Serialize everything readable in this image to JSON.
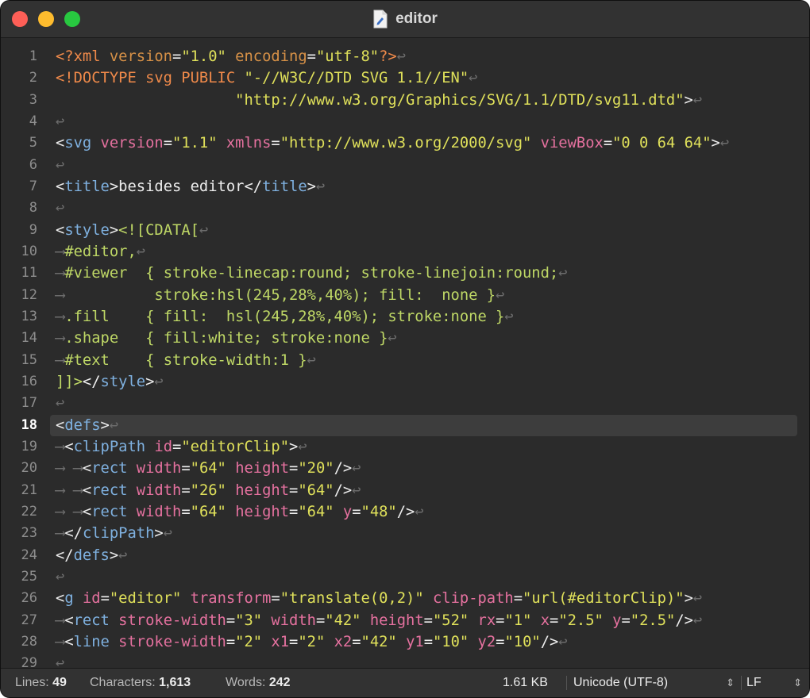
{
  "window": {
    "title": "editor"
  },
  "colors": {
    "background": "#2b2b2b",
    "tag": "#7fb1e0",
    "attribute": "#e5719f",
    "string": "#dfe05a",
    "css": "#bfd866",
    "declaration": "#f08a4a"
  },
  "editor": {
    "current_line": 18,
    "lines": [
      [
        [
          "<?xml ",
          "decl"
        ],
        [
          "version",
          "xmlattr"
        ],
        [
          "=",
          "punct"
        ],
        [
          "\"1.0\"",
          "str"
        ],
        [
          " ",
          "text"
        ],
        [
          "encoding",
          "xmlattr"
        ],
        [
          "=",
          "punct"
        ],
        [
          "\"utf-8\"",
          "str"
        ],
        [
          "?>",
          "decl"
        ],
        [
          "↩",
          "inv"
        ]
      ],
      [
        [
          "<!DOCTYPE svg PUBLIC ",
          "decl"
        ],
        [
          "\"-//W3C//DTD SVG 1.1//EN\"",
          "str"
        ],
        [
          "↩",
          "inv"
        ]
      ],
      [
        [
          "                    ",
          "text"
        ],
        [
          "\"http://www.w3.org/Graphics/SVG/1.1/DTD/svg11.dtd\"",
          "str"
        ],
        [
          ">",
          "punct"
        ],
        [
          "↩",
          "inv"
        ]
      ],
      [
        [
          "↩",
          "inv"
        ]
      ],
      [
        [
          "<",
          "punct"
        ],
        [
          "svg",
          "tag"
        ],
        [
          " ",
          "text"
        ],
        [
          "version",
          "attr"
        ],
        [
          "=",
          "punct"
        ],
        [
          "\"1.1\"",
          "str"
        ],
        [
          " ",
          "text"
        ],
        [
          "xmlns",
          "attr"
        ],
        [
          "=",
          "punct"
        ],
        [
          "\"http://www.w3.org/2000/svg\"",
          "str"
        ],
        [
          " ",
          "text"
        ],
        [
          "viewBox",
          "attr"
        ],
        [
          "=",
          "punct"
        ],
        [
          "\"0 0 64 64\"",
          "str"
        ],
        [
          ">",
          "punct"
        ],
        [
          "↩",
          "inv"
        ]
      ],
      [
        [
          "↩",
          "inv"
        ]
      ],
      [
        [
          "<",
          "punct"
        ],
        [
          "title",
          "tag"
        ],
        [
          ">",
          "punct"
        ],
        [
          "besides editor",
          "text"
        ],
        [
          "</",
          "punct"
        ],
        [
          "title",
          "tag"
        ],
        [
          ">",
          "punct"
        ],
        [
          "↩",
          "inv"
        ]
      ],
      [
        [
          "↩",
          "inv"
        ]
      ],
      [
        [
          "<",
          "punct"
        ],
        [
          "style",
          "tag"
        ],
        [
          ">",
          "punct"
        ],
        [
          "<![CDATA[",
          "css"
        ],
        [
          "↩",
          "inv"
        ]
      ],
      [
        [
          "⟶",
          "inv"
        ],
        [
          "#editor,",
          "css"
        ],
        [
          "↩",
          "inv"
        ]
      ],
      [
        [
          "⟶",
          "inv"
        ],
        [
          "#viewer  { stroke-linecap:round; stroke-linejoin:round;",
          "css"
        ],
        [
          "↩",
          "inv"
        ]
      ],
      [
        [
          "⟶",
          "inv"
        ],
        [
          "          stroke:hsl(245,28%,40%); fill:  none }",
          "css"
        ],
        [
          "↩",
          "inv"
        ]
      ],
      [
        [
          "⟶",
          "inv"
        ],
        [
          ".fill    { fill:  hsl(245,28%,40%); stroke:none }",
          "css"
        ],
        [
          "↩",
          "inv"
        ]
      ],
      [
        [
          "⟶",
          "inv"
        ],
        [
          ".shape   { fill:white; stroke:none }",
          "css"
        ],
        [
          "↩",
          "inv"
        ]
      ],
      [
        [
          "⟶",
          "inv"
        ],
        [
          "#text    { stroke-width:1 }",
          "css"
        ],
        [
          "↩",
          "inv"
        ]
      ],
      [
        [
          "]]>",
          "css"
        ],
        [
          "</",
          "punct"
        ],
        [
          "style",
          "tag"
        ],
        [
          ">",
          "punct"
        ],
        [
          "↩",
          "inv"
        ]
      ],
      [
        [
          "↩",
          "inv"
        ]
      ],
      [
        [
          "<",
          "punct"
        ],
        [
          "defs",
          "tag"
        ],
        [
          ">",
          "punct"
        ],
        [
          "↩",
          "inv"
        ]
      ],
      [
        [
          "⟶",
          "inv"
        ],
        [
          "<",
          "punct"
        ],
        [
          "clipPath",
          "tag"
        ],
        [
          " ",
          "text"
        ],
        [
          "id",
          "attr"
        ],
        [
          "=",
          "punct"
        ],
        [
          "\"editorClip\"",
          "str"
        ],
        [
          ">",
          "punct"
        ],
        [
          "↩",
          "inv"
        ]
      ],
      [
        [
          "⟶ ⟶",
          "inv"
        ],
        [
          "<",
          "punct"
        ],
        [
          "rect",
          "tag"
        ],
        [
          " ",
          "text"
        ],
        [
          "width",
          "attr"
        ],
        [
          "=",
          "punct"
        ],
        [
          "\"64\"",
          "str"
        ],
        [
          " ",
          "text"
        ],
        [
          "height",
          "attr"
        ],
        [
          "=",
          "punct"
        ],
        [
          "\"20\"",
          "str"
        ],
        [
          "/>",
          "punct"
        ],
        [
          "↩",
          "inv"
        ]
      ],
      [
        [
          "⟶ ⟶",
          "inv"
        ],
        [
          "<",
          "punct"
        ],
        [
          "rect",
          "tag"
        ],
        [
          " ",
          "text"
        ],
        [
          "width",
          "attr"
        ],
        [
          "=",
          "punct"
        ],
        [
          "\"26\"",
          "str"
        ],
        [
          " ",
          "text"
        ],
        [
          "height",
          "attr"
        ],
        [
          "=",
          "punct"
        ],
        [
          "\"64\"",
          "str"
        ],
        [
          "/>",
          "punct"
        ],
        [
          "↩",
          "inv"
        ]
      ],
      [
        [
          "⟶ ⟶",
          "inv"
        ],
        [
          "<",
          "punct"
        ],
        [
          "rect",
          "tag"
        ],
        [
          " ",
          "text"
        ],
        [
          "width",
          "attr"
        ],
        [
          "=",
          "punct"
        ],
        [
          "\"64\"",
          "str"
        ],
        [
          " ",
          "text"
        ],
        [
          "height",
          "attr"
        ],
        [
          "=",
          "punct"
        ],
        [
          "\"64\"",
          "str"
        ],
        [
          " ",
          "text"
        ],
        [
          "y",
          "attr"
        ],
        [
          "=",
          "punct"
        ],
        [
          "\"48\"",
          "str"
        ],
        [
          "/>",
          "punct"
        ],
        [
          "↩",
          "inv"
        ]
      ],
      [
        [
          "⟶",
          "inv"
        ],
        [
          "</",
          "punct"
        ],
        [
          "clipPath",
          "tag"
        ],
        [
          ">",
          "punct"
        ],
        [
          "↩",
          "inv"
        ]
      ],
      [
        [
          "</",
          "punct"
        ],
        [
          "defs",
          "tag"
        ],
        [
          ">",
          "punct"
        ],
        [
          "↩",
          "inv"
        ]
      ],
      [
        [
          "↩",
          "inv"
        ]
      ],
      [
        [
          "<",
          "punct"
        ],
        [
          "g",
          "tag"
        ],
        [
          " ",
          "text"
        ],
        [
          "id",
          "attr"
        ],
        [
          "=",
          "punct"
        ],
        [
          "\"editor\"",
          "str"
        ],
        [
          " ",
          "text"
        ],
        [
          "transform",
          "attr"
        ],
        [
          "=",
          "punct"
        ],
        [
          "\"translate(0,2)\"",
          "str"
        ],
        [
          " ",
          "text"
        ],
        [
          "clip-path",
          "attr"
        ],
        [
          "=",
          "punct"
        ],
        [
          "\"url(#editorClip)\"",
          "str"
        ],
        [
          ">",
          "punct"
        ],
        [
          "↩",
          "inv"
        ]
      ],
      [
        [
          "⟶",
          "inv"
        ],
        [
          "<",
          "punct"
        ],
        [
          "rect",
          "tag"
        ],
        [
          " ",
          "text"
        ],
        [
          "stroke-width",
          "attr"
        ],
        [
          "=",
          "punct"
        ],
        [
          "\"3\"",
          "str"
        ],
        [
          " ",
          "text"
        ],
        [
          "width",
          "attr"
        ],
        [
          "=",
          "punct"
        ],
        [
          "\"42\"",
          "str"
        ],
        [
          " ",
          "text"
        ],
        [
          "height",
          "attr"
        ],
        [
          "=",
          "punct"
        ],
        [
          "\"52\"",
          "str"
        ],
        [
          " ",
          "text"
        ],
        [
          "rx",
          "attr"
        ],
        [
          "=",
          "punct"
        ],
        [
          "\"1\"",
          "str"
        ],
        [
          " ",
          "text"
        ],
        [
          "x",
          "attr"
        ],
        [
          "=",
          "punct"
        ],
        [
          "\"2.5\"",
          "str"
        ],
        [
          " ",
          "text"
        ],
        [
          "y",
          "attr"
        ],
        [
          "=",
          "punct"
        ],
        [
          "\"2.5\"",
          "str"
        ],
        [
          "/>",
          "punct"
        ],
        [
          "↩",
          "inv"
        ]
      ],
      [
        [
          "⟶",
          "inv"
        ],
        [
          "<",
          "punct"
        ],
        [
          "line",
          "tag"
        ],
        [
          " ",
          "text"
        ],
        [
          "stroke-width",
          "attr"
        ],
        [
          "=",
          "punct"
        ],
        [
          "\"2\"",
          "str"
        ],
        [
          " ",
          "text"
        ],
        [
          "x1",
          "attr"
        ],
        [
          "=",
          "punct"
        ],
        [
          "\"2\"",
          "str"
        ],
        [
          " ",
          "text"
        ],
        [
          "x2",
          "attr"
        ],
        [
          "=",
          "punct"
        ],
        [
          "\"42\"",
          "str"
        ],
        [
          " ",
          "text"
        ],
        [
          "y1",
          "attr"
        ],
        [
          "=",
          "punct"
        ],
        [
          "\"10\"",
          "str"
        ],
        [
          " ",
          "text"
        ],
        [
          "y2",
          "attr"
        ],
        [
          "=",
          "punct"
        ],
        [
          "\"10\"",
          "str"
        ],
        [
          "/>",
          "punct"
        ],
        [
          "↩",
          "inv"
        ]
      ],
      [
        [
          "↩",
          "inv"
        ]
      ]
    ]
  },
  "status": {
    "lines_label": "Lines:",
    "lines_value": "49",
    "chars_label": "Characters:",
    "chars_value": "1,613",
    "words_label": "Words:",
    "words_value": "242",
    "size": "1.61 KB",
    "encoding": "Unicode (UTF-8)",
    "line_ending": "LF",
    "stepper_icon": "up-down-chevron-icon"
  }
}
